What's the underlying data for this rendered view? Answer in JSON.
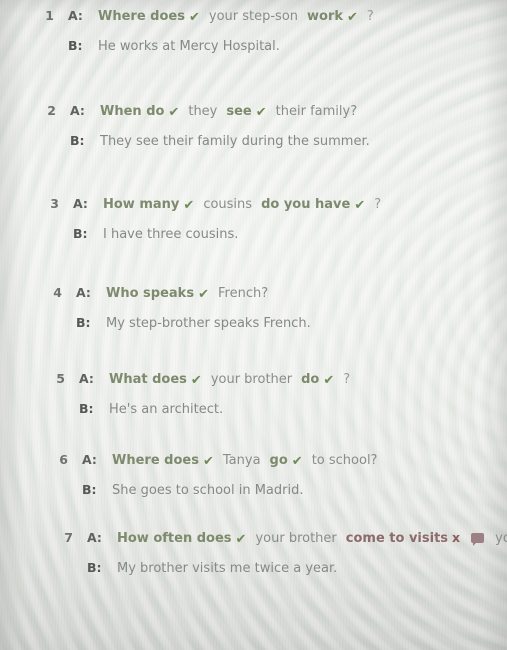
{
  "exercise": {
    "icons": {
      "correct": "check-icon",
      "incorrect": "cross-icon",
      "comment": "speech-bubble-icon"
    },
    "colors": {
      "correct_green": "#7d8a6d",
      "check_green": "#6f8a57",
      "incorrect_red": "#8d6a6b",
      "cross_red": "#8b5d5d",
      "bubble_mauve": "#9d8084",
      "plain_gray": "#8a8d87",
      "label_gray": "#5e625d",
      "page_background": "#e7e8e3"
    },
    "speaker_labels": {
      "a": "A:",
      "b": "B:"
    },
    "items": [
      {
        "number": "1",
        "question_segments": [
          {
            "text": "Where does",
            "style": "correct-bold",
            "mark": "check"
          },
          {
            "text": "your step-son",
            "style": "plain",
            "mark": "none"
          },
          {
            "text": "work",
            "style": "correct-bold",
            "mark": "check"
          },
          {
            "text": "?",
            "style": "punct",
            "mark": "none"
          }
        ],
        "answer": "He works at Mercy Hospital."
      },
      {
        "number": "2",
        "question_segments": [
          {
            "text": "When do",
            "style": "correct-bold",
            "mark": "check"
          },
          {
            "text": "they",
            "style": "plain",
            "mark": "none"
          },
          {
            "text": "see",
            "style": "correct-bold",
            "mark": "check"
          },
          {
            "text": "their family?",
            "style": "plain",
            "mark": "none"
          }
        ],
        "answer": "They see their family during the summer."
      },
      {
        "number": "3",
        "question_segments": [
          {
            "text": "How many",
            "style": "correct-bold",
            "mark": "check"
          },
          {
            "text": "cousins",
            "style": "plain",
            "mark": "none"
          },
          {
            "text": "do you have",
            "style": "correct-bold",
            "mark": "check"
          },
          {
            "text": "?",
            "style": "punct",
            "mark": "none"
          }
        ],
        "answer": "I have three cousins."
      },
      {
        "number": "4",
        "question_segments": [
          {
            "text": "Who speaks",
            "style": "correct-bold",
            "mark": "check"
          },
          {
            "text": "French?",
            "style": "plain",
            "mark": "none"
          }
        ],
        "answer": "My step-brother speaks French."
      },
      {
        "number": "5",
        "question_segments": [
          {
            "text": "What does",
            "style": "correct-bold",
            "mark": "check"
          },
          {
            "text": "your brother",
            "style": "plain",
            "mark": "none"
          },
          {
            "text": "do",
            "style": "correct-bold",
            "mark": "check"
          },
          {
            "text": "?",
            "style": "punct",
            "mark": "none"
          }
        ],
        "answer": "He's an architect."
      },
      {
        "number": "6",
        "question_segments": [
          {
            "text": "Where does",
            "style": "correct-bold",
            "mark": "check"
          },
          {
            "text": "Tanya",
            "style": "plain",
            "mark": "none"
          },
          {
            "text": "go",
            "style": "correct-bold",
            "mark": "check"
          },
          {
            "text": "to school?",
            "style": "plain",
            "mark": "none"
          }
        ],
        "answer": "She goes to school in Madrid."
      },
      {
        "number": "7",
        "question_segments": [
          {
            "text": "How often does",
            "style": "correct-bold",
            "mark": "check"
          },
          {
            "text": "your brother",
            "style": "plain",
            "mark": "none"
          },
          {
            "text": "come to visits",
            "style": "wrong-bold",
            "mark": "cross-bubble"
          },
          {
            "text": "you?",
            "style": "plain",
            "mark": "none"
          }
        ],
        "answer": "My brother visits me twice a year."
      }
    ]
  },
  "layout": {
    "item_tops": [
      8,
      103,
      196,
      285,
      371,
      452,
      530
    ],
    "item_indents": [
      38,
      40,
      43,
      46,
      49,
      52,
      57
    ],
    "answer_offsets": [
      38,
      38,
      38,
      38,
      38,
      38,
      33
    ]
  }
}
